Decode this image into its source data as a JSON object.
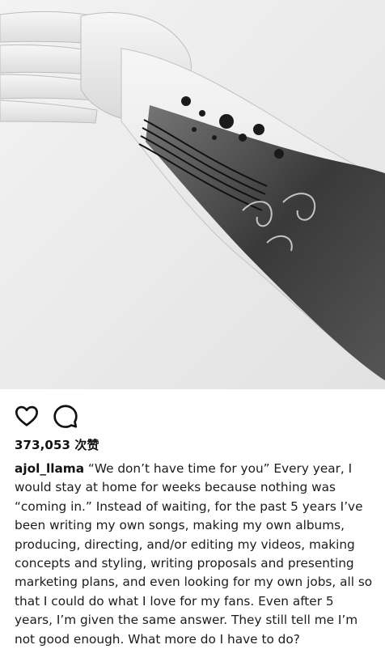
{
  "post": {
    "image": {
      "subject": "photo-of-tattooed-forearm",
      "style": "black-and-white"
    },
    "actions": [
      {
        "name": "like",
        "icon": "heart-outline-icon"
      },
      {
        "name": "comment",
        "icon": "speech-bubble-icon"
      }
    ],
    "likes": {
      "count": "373,053",
      "suffix": "次赞"
    },
    "caption": {
      "username": "ajol_llama",
      "text": " “We don’t have time for you” Every year, I would stay at home for weeks because nothing was “coming in.” Instead of waiting, for the past 5 years I’ve been writing my own songs, making my own albums, producing, directing, and/or editing my videos, making concepts and styling, writing proposals and presenting marketing plans, and even looking for my own jobs, all so that I could do what I love for my fans. Even after 5 years, I’m given the same answer. They still tell me I’m not good enough. What more do I have to do?"
    }
  },
  "colors": {
    "background": "#ffffff",
    "text": "#111111",
    "icon": "#111111"
  }
}
